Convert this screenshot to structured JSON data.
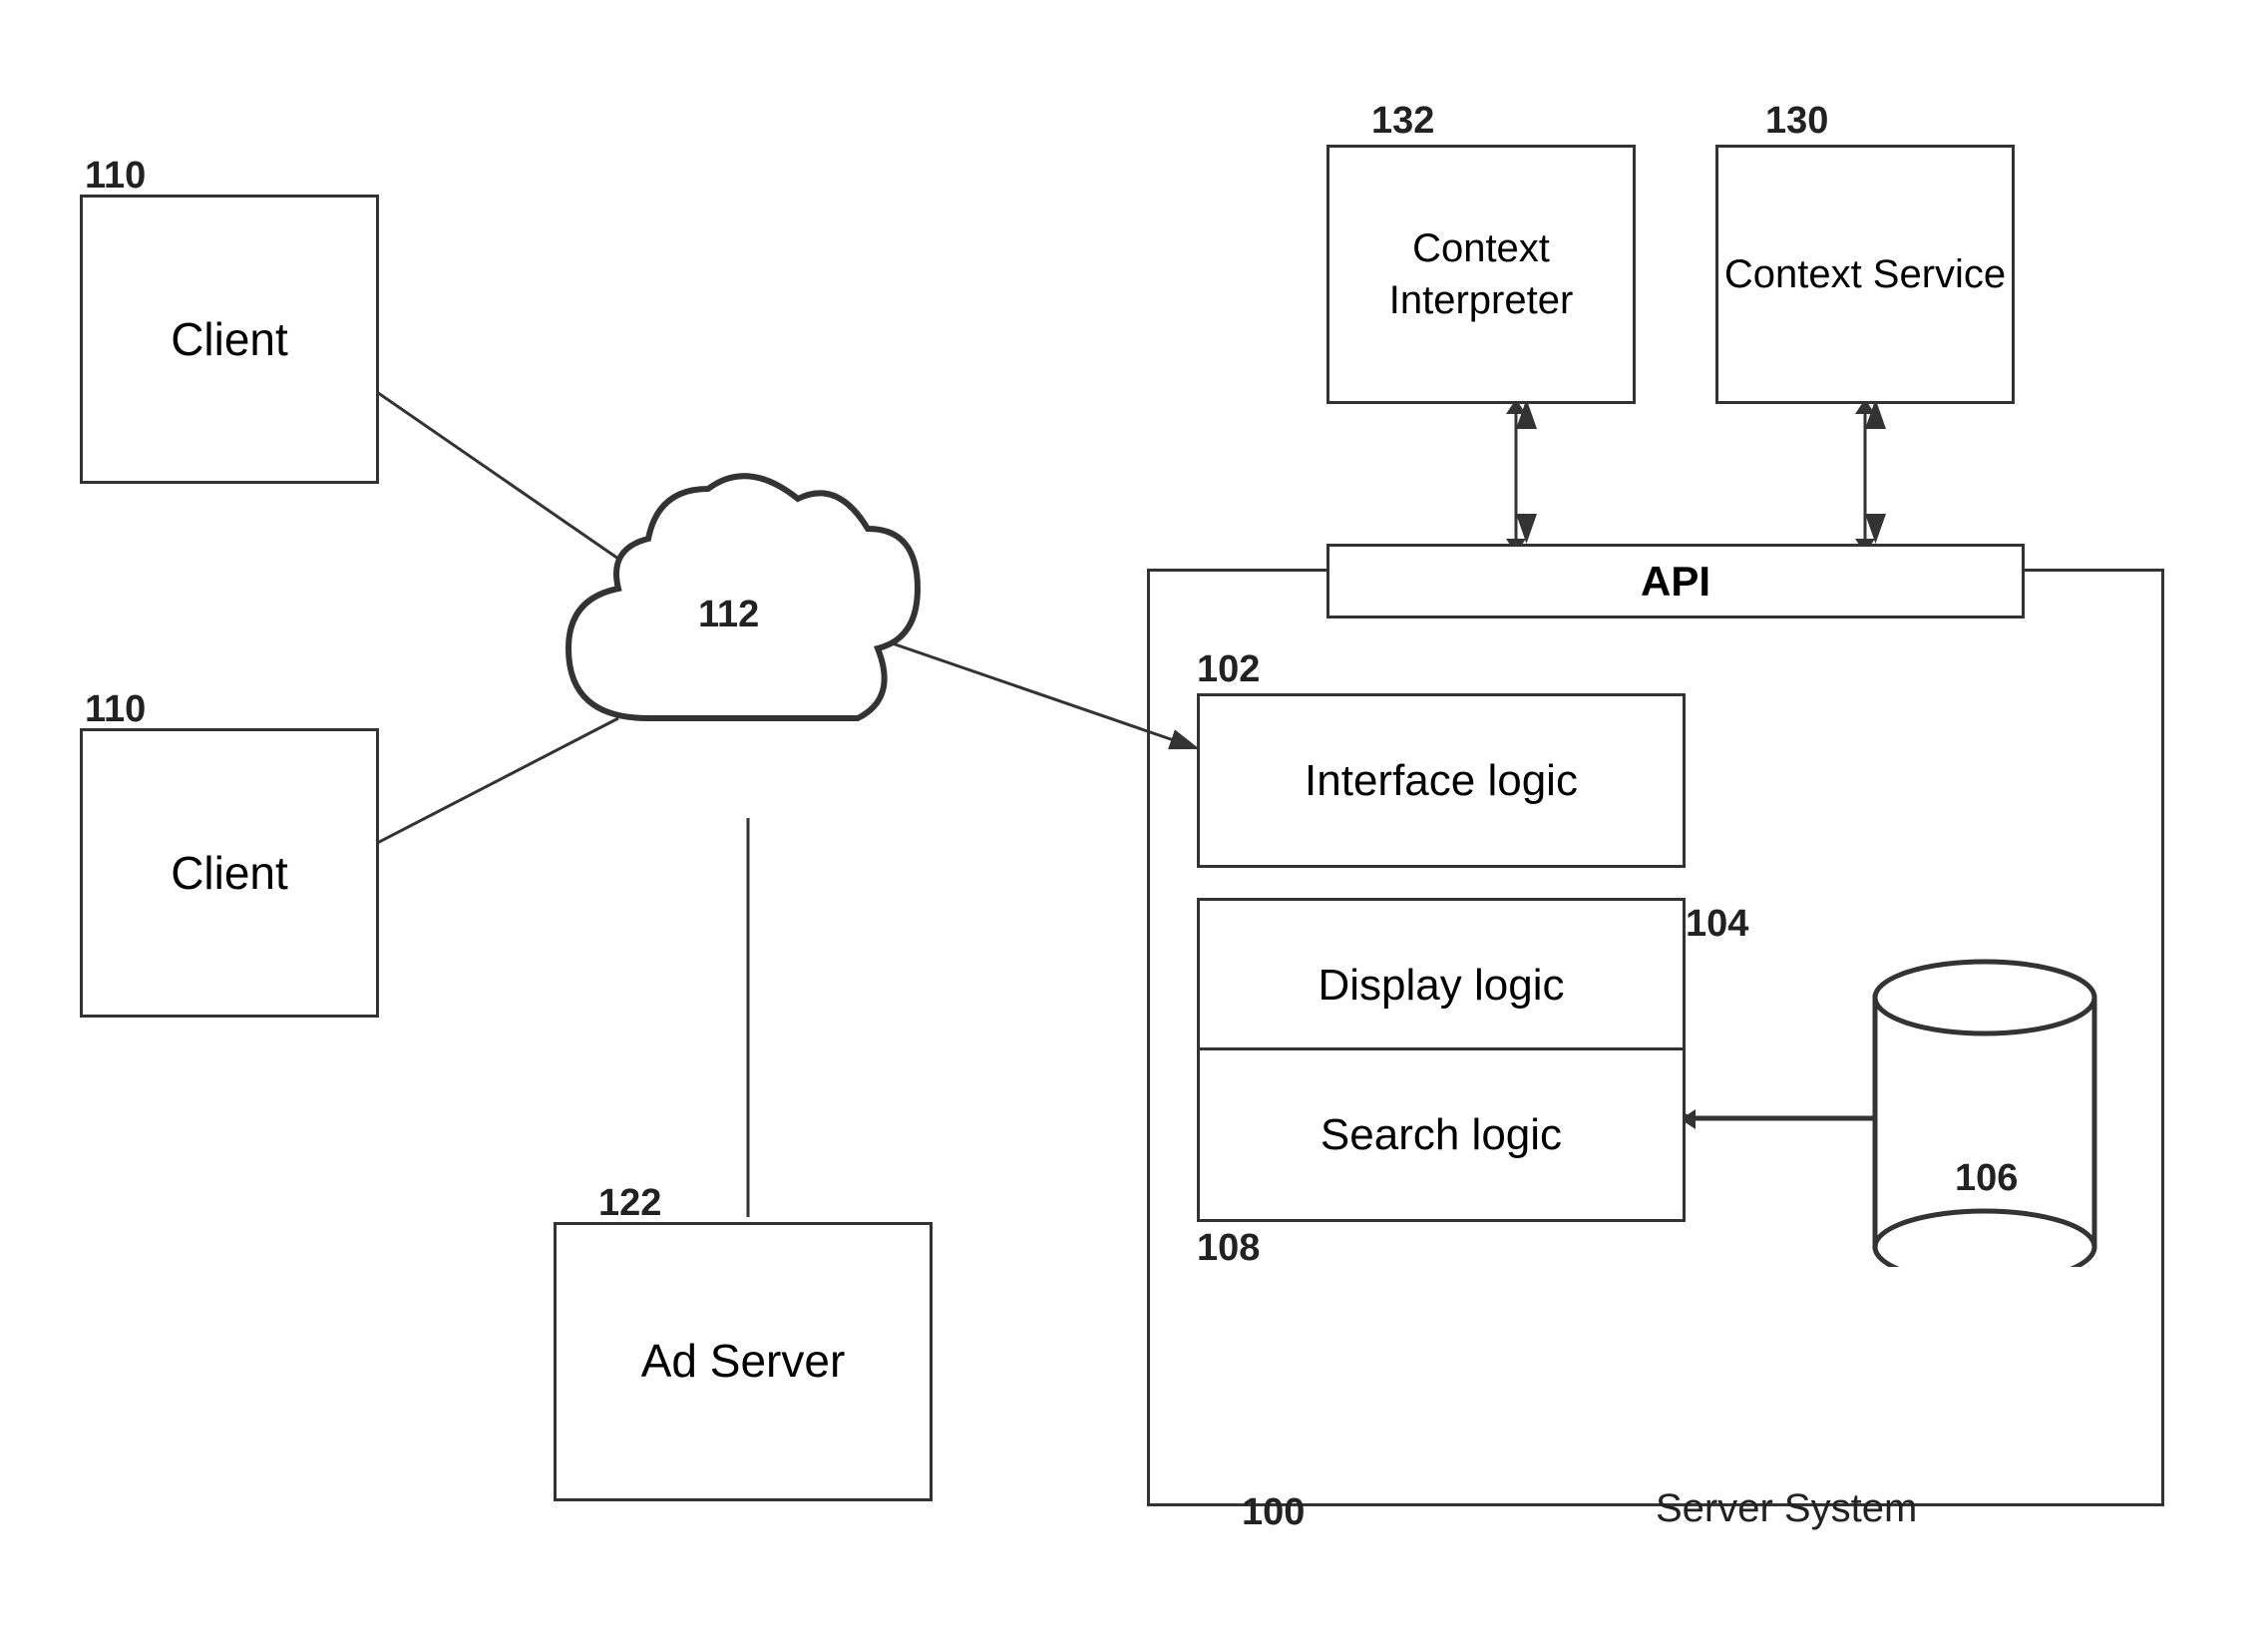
{
  "labels": {
    "client1_num": "110",
    "client2_num": "110",
    "client_text": "Client",
    "network_num": "112",
    "ad_server_num": "122",
    "ad_server_text": "Ad Server",
    "context_interpreter_num": "132",
    "context_interpreter_text": "Context Interpreter",
    "context_service_num": "130",
    "context_service_text": "Context Service",
    "api_text": "API",
    "interface_logic_num": "102",
    "interface_logic_text": "Interface logic",
    "display_logic_text": "Display logic",
    "display_logic_num": "104",
    "search_logic_text": "Search logic",
    "search_logic_num": "108",
    "db_num": "106",
    "server_system_num": "100",
    "server_system_text": "Server System"
  }
}
